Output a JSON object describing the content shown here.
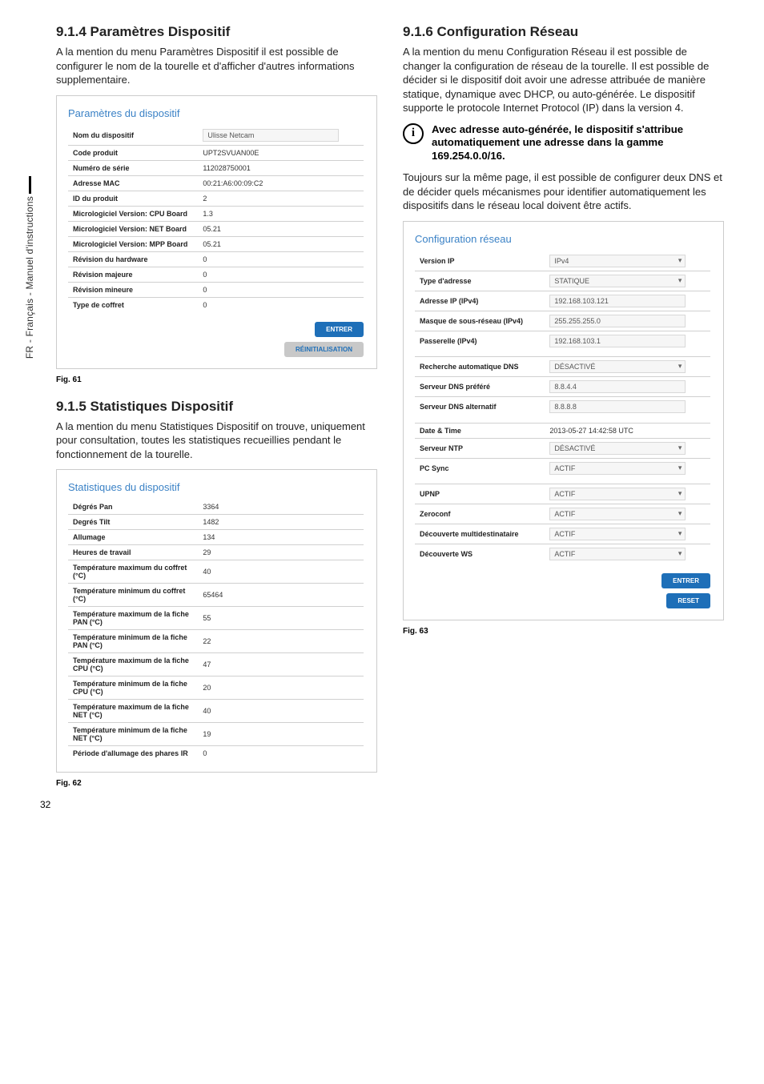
{
  "page": {
    "number": "32",
    "side_tab": "FR - Français - Manuel d'instructions"
  },
  "left": {
    "s914": {
      "heading": "9.1.4 Paramètres Dispositif",
      "para": "A la mention du menu Paramètres Dispositif il est possible de configurer le nom de la tourelle et d'afficher d'autres informations supplementaire.",
      "panel_title": "Paramètres du dispositif",
      "rows": {
        "r0l": "Nom du dispositif",
        "r0v": "Ulisse Netcam",
        "r1l": "Code produit",
        "r1v": "UPT2SVUAN00E",
        "r2l": "Numéro de série",
        "r2v": "112028750001",
        "r3l": "Adresse MAC",
        "r3v": "00:21:A6:00:09:C2",
        "r4l": "ID du produit",
        "r4v": "2",
        "r5l": "Micrologiciel Version: CPU Board",
        "r5v": "1.3",
        "r6l": "Micrologiciel Version: NET Board",
        "r6v": "05.21",
        "r7l": "Micrologiciel Version: MPP Board",
        "r7v": "05.21",
        "r8l": "Révision du hardware",
        "r8v": "0",
        "r9l": "Révision majeure",
        "r9v": "0",
        "r10l": "Révision mineure",
        "r10v": "0",
        "r11l": "Type de coffret",
        "r11v": "0"
      },
      "btn_entrer": "ENTRER",
      "btn_reinit": "RÉINITIALISATION",
      "fig": "Fig. 61"
    },
    "s915": {
      "heading": "9.1.5 Statistiques Dispositif",
      "para": "A la mention du menu Statistiques Dispositif on trouve, uniquement pour consultation, toutes les statistiques recueillies pendant le fonctionnement de la tourelle.",
      "panel_title": "Statistiques du dispositif",
      "rows": {
        "r0l": "Dégrés Pan",
        "r0v": "3364",
        "r1l": "Degrés Tilt",
        "r1v": "1482",
        "r2l": "Allumage",
        "r2v": "134",
        "r3l": "Heures de travail",
        "r3v": "29",
        "r4l": "Température maximum du coffret (°C)",
        "r4v": "40",
        "r5l": "Température minimum du coffret (°C)",
        "r5v": "65464",
        "r6l": "Température maximum de la fiche PAN (°C)",
        "r6v": "55",
        "r7l": "Température minimum de la fiche PAN (°C)",
        "r7v": "22",
        "r8l": "Température maximum de la fiche CPU (°C)",
        "r8v": "47",
        "r9l": "Température minimum de la fiche CPU (°C)",
        "r9v": "20",
        "r10l": "Température maximum de la fiche NET (°C)",
        "r10v": "40",
        "r11l": "Température minimum de la fiche NET (°C)",
        "r11v": "19",
        "r12l": "Période d'allumage des phares IR",
        "r12v": "0"
      },
      "fig": "Fig. 62"
    }
  },
  "right": {
    "s916": {
      "heading": "9.1.6 Configuration Réseau",
      "para1": "A la mention du menu Configuration Réseau il est possible de changer la configuration de réseau de la tourelle. Il est possible de décider si le dispositif doit avoir une adresse attribuée de manière statique, dynamique avec DHCP, ou auto-générée. Le dispositif supporte le protocole Internet Protocol (IP) dans la version 4.",
      "info": "Avec adresse auto-générée, le dispositif s'attribue automatiquement une adresse dans la gamme 169.254.0.0/16.",
      "para2": "Toujours sur la même page, il est possible de configurer deux DNS et de décider quels mécanismes pour identifier automatiquement les dispositifs dans le réseau local doivent être actifs.",
      "panel_title": "Configuration réseau",
      "rows": {
        "r0l": "Version IP",
        "r0v": "IPv4",
        "r1l": "Type d'adresse",
        "r1v": "STATIQUE",
        "r2l": "Adresse IP (IPv4)",
        "r2v": "192.168.103.121",
        "r3l": "Masque de sous-réseau (IPv4)",
        "r3v": "255.255.255.0",
        "r4l": "Passerelle (IPv4)",
        "r4v": "192.168.103.1",
        "r5l": "Recherche automatique DNS",
        "r5v": "DÉSACTIVÉ",
        "r6l": "Serveur DNS préféré",
        "r6v": "8.8.4.4",
        "r7l": "Serveur DNS alternatif",
        "r7v": "8.8.8.8",
        "r8l": "Date & Time",
        "r8v": "2013-05-27 14:42:58 UTC",
        "r9l": "Serveur NTP",
        "r9v": "DÉSACTIVÉ",
        "r10l": "PC Sync",
        "r10v": "ACTIF",
        "r11l": "UPNP",
        "r11v": "ACTIF",
        "r12l": "Zeroconf",
        "r12v": "ACTIF",
        "r13l": "Découverte multidestinataire",
        "r13v": "ACTIF",
        "r14l": "Découverte WS",
        "r14v": "ACTIF"
      },
      "btn_entrer": "ENTRER",
      "btn_reset": "RESET",
      "fig": "Fig. 63"
    }
  }
}
